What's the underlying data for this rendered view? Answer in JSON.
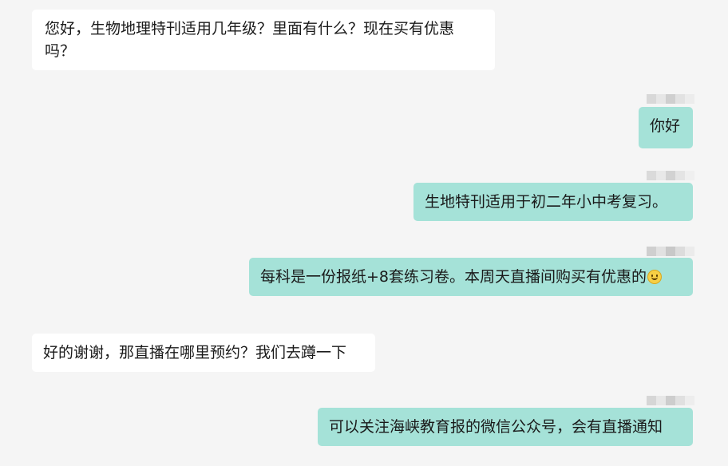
{
  "conversation": {
    "messages": [
      {
        "sender": "customer",
        "text": "您好，生物地理特刊适用几年级？里面有什么？现在买有优惠吗？"
      },
      {
        "sender": "seller",
        "text": "你好"
      },
      {
        "sender": "seller",
        "text": "生地特刊适用于初二年小中考复习。"
      },
      {
        "sender": "seller",
        "text": "每科是一份报纸+8套练习卷。本周天直播间购买有优惠的",
        "emoji": "smiling-face-icon"
      },
      {
        "sender": "customer",
        "text": "好的谢谢，那直播在哪里预约？我们去蹲一下"
      },
      {
        "sender": "seller",
        "text": "可以关注海峡教育报的微信公众号，会有直播通知"
      }
    ]
  },
  "colors": {
    "background": "#f5f5f5",
    "incoming_bubble": "#ffffff",
    "outgoing_bubble": "#a5e2d8",
    "text": "#1a1a1a"
  }
}
